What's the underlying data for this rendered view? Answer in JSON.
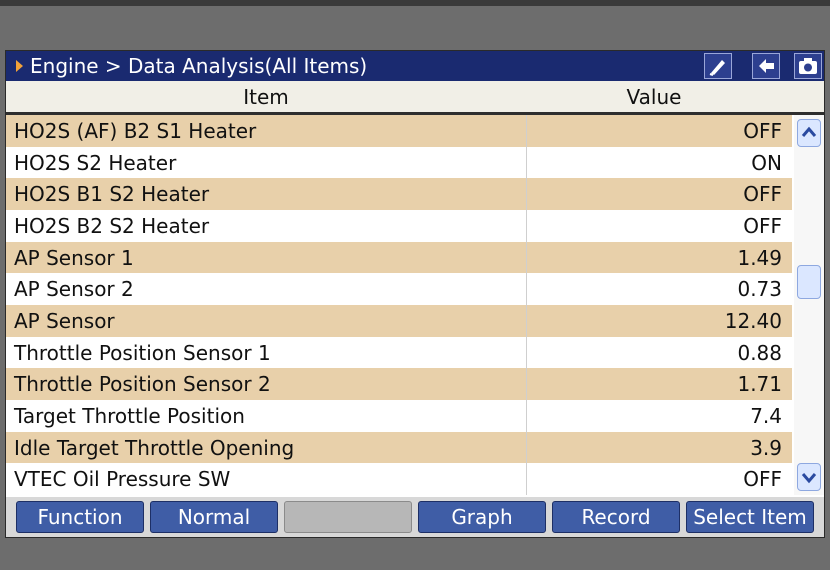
{
  "title": {
    "breadcrumb": "Engine > Data Analysis(All Items)"
  },
  "toolbar_icons": [
    "pen-icon",
    "back-arrow-icon",
    "camera-icon"
  ],
  "table": {
    "headers": {
      "item": "Item",
      "value": "Value"
    },
    "rows": [
      {
        "item": "HO2S (AF) B2 S1 Heater",
        "value": "OFF"
      },
      {
        "item": "HO2S S2 Heater",
        "value": "ON"
      },
      {
        "item": "HO2S B1 S2 Heater",
        "value": "OFF"
      },
      {
        "item": "HO2S B2 S2 Heater",
        "value": "OFF"
      },
      {
        "item": "AP Sensor 1",
        "value": "1.49"
      },
      {
        "item": "AP Sensor 2",
        "value": "0.73"
      },
      {
        "item": "AP Sensor",
        "value": "12.40"
      },
      {
        "item": "Throttle Position Sensor 1",
        "value": "0.88"
      },
      {
        "item": "Throttle Position Sensor 2",
        "value": "1.71"
      },
      {
        "item": "Target Throttle Position",
        "value": "7.4"
      },
      {
        "item": "Idle Target Throttle Opening",
        "value": "3.9"
      },
      {
        "item": "VTEC Oil Pressure SW",
        "value": "OFF"
      }
    ]
  },
  "buttons": {
    "function": "Function",
    "normal": "Normal",
    "blank": "",
    "graph": "Graph",
    "record": "Record",
    "select_item": "Select Item"
  },
  "colors": {
    "title_bar": "#1a2a70",
    "row_stripe": "#e8d0aa",
    "button": "#3f5da6"
  }
}
